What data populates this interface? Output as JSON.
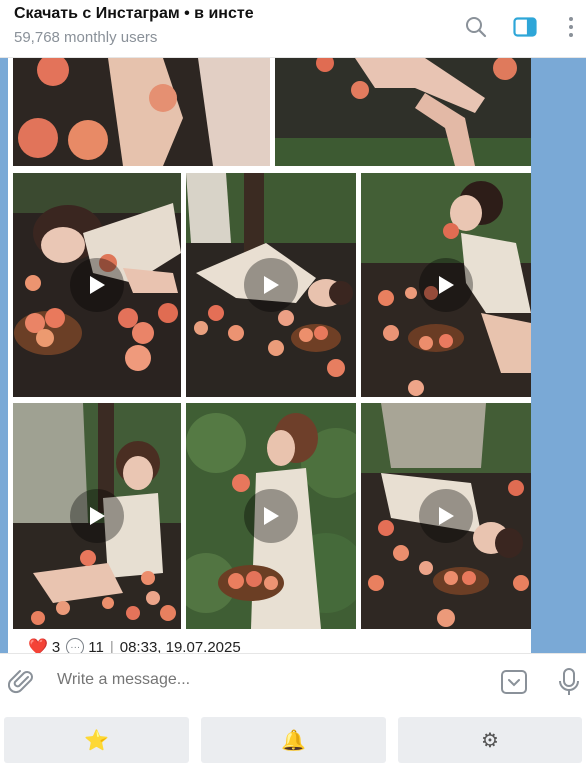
{
  "header": {
    "title": "Скачать с Инстаграм • в инсте",
    "subtitle": "59,768 monthly users"
  },
  "post": {
    "reactions": [
      {
        "icon": "❤️",
        "count": "3"
      },
      {
        "icon": "💬",
        "count": "11"
      }
    ],
    "separator": "|",
    "timestamp": "08:33, 19.07.2025"
  },
  "composer": {
    "placeholder": "Write a message..."
  },
  "keyboard": {
    "buttons": [
      {
        "icon": "⭐"
      },
      {
        "icon": "🔔"
      },
      {
        "icon": "⚙"
      }
    ]
  },
  "colors": {
    "accent": "#2ea6d8",
    "chat_background": "#7aa9d6"
  }
}
